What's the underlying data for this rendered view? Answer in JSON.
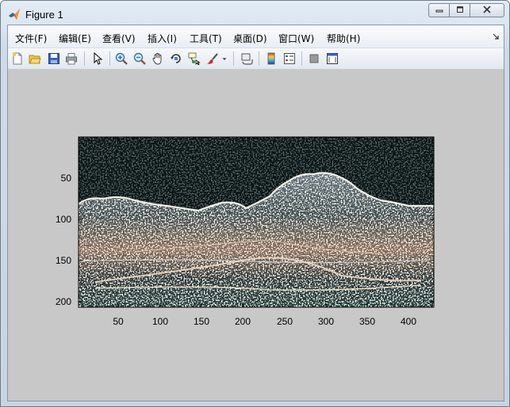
{
  "window": {
    "title": "Figure 1",
    "controls": {
      "minimize": "▭",
      "maximize": "□",
      "close": "✕"
    }
  },
  "menubar": {
    "items": [
      {
        "label": "文件(F)"
      },
      {
        "label": "编辑(E)"
      },
      {
        "label": "查看(V)"
      },
      {
        "label": "插入(I)"
      },
      {
        "label": "工具(T)"
      },
      {
        "label": "桌面(D)"
      },
      {
        "label": "窗口(W)"
      },
      {
        "label": "帮助(H)"
      }
    ],
    "overflow_icon": "corner-arrow-icon"
  },
  "toolbar": {
    "buttons": [
      {
        "name": "new-figure-icon"
      },
      {
        "name": "open-file-icon"
      },
      {
        "name": "save-icon"
      },
      {
        "name": "print-icon"
      },
      {
        "name": "edit-plot-icon"
      },
      {
        "name": "zoom-in-icon"
      },
      {
        "name": "zoom-out-icon"
      },
      {
        "name": "pan-icon"
      },
      {
        "name": "rotate-3d-icon"
      },
      {
        "name": "data-cursor-icon"
      },
      {
        "name": "brush-icon"
      },
      {
        "name": "link-plot-icon"
      },
      {
        "name": "colorbar-icon"
      },
      {
        "name": "legend-icon"
      },
      {
        "name": "hide-plot-tools-icon"
      },
      {
        "name": "show-plot-tools-icon"
      }
    ]
  },
  "axes": {
    "x_ticks": [
      "50",
      "100",
      "150",
      "200",
      "250",
      "300",
      "350",
      "400"
    ],
    "y_ticks": [
      "50",
      "100",
      "150",
      "200"
    ],
    "image_description_colors": {
      "background": "#c8c8c8",
      "sky": "#071416",
      "edges": "#e8e4d4"
    }
  }
}
